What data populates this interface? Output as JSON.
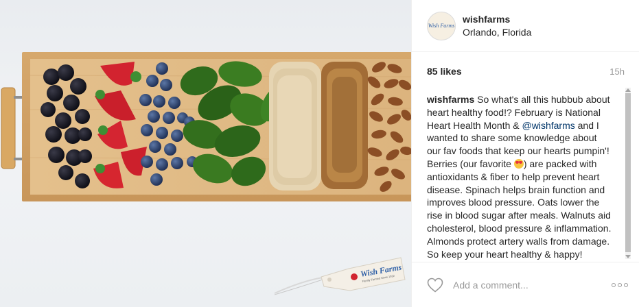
{
  "photo": {
    "alt": "Board of blackberries, strawberries, blueberries, spinach, oats, walnuts and almonds",
    "tag_brand": "Wish Farms",
    "tag_tagline": "Family Farmed Since 1922"
  },
  "header": {
    "avatar_text": "Wish Farms",
    "username": "wishfarms",
    "location": "Orlando, Florida"
  },
  "stats": {
    "likes": "85 likes",
    "time": "15h"
  },
  "caption": {
    "username": "wishfarms",
    "text_1": "So what's all this hubbub about heart healthy food!? February is National Heart Health Month &",
    "mention": "@wishfarms",
    "text_2": "and I wanted to share some knowledge about our fav foods that keep our hearts pumpin'! Berries (our favorite",
    "text_3": ") are packed with antioxidants & fiber to help prevent heart disease. Spinach helps brain function and improves blood pressure. Oats lower the rise in blood sugar after meals. Walnuts aid cholesterol, blood pressure & inflammation. Almonds protect artery walls from damage. So keep your heart healthy & happy!"
  },
  "comment": {
    "placeholder": "Add a comment..."
  },
  "icons": {
    "like": "heart-icon",
    "more": "more-options-icon",
    "emoji": "heart-eyes-emoji-icon"
  },
  "colors": {
    "text": "#262626",
    "muted": "#999999",
    "mention": "#003569",
    "border": "#efefef"
  }
}
